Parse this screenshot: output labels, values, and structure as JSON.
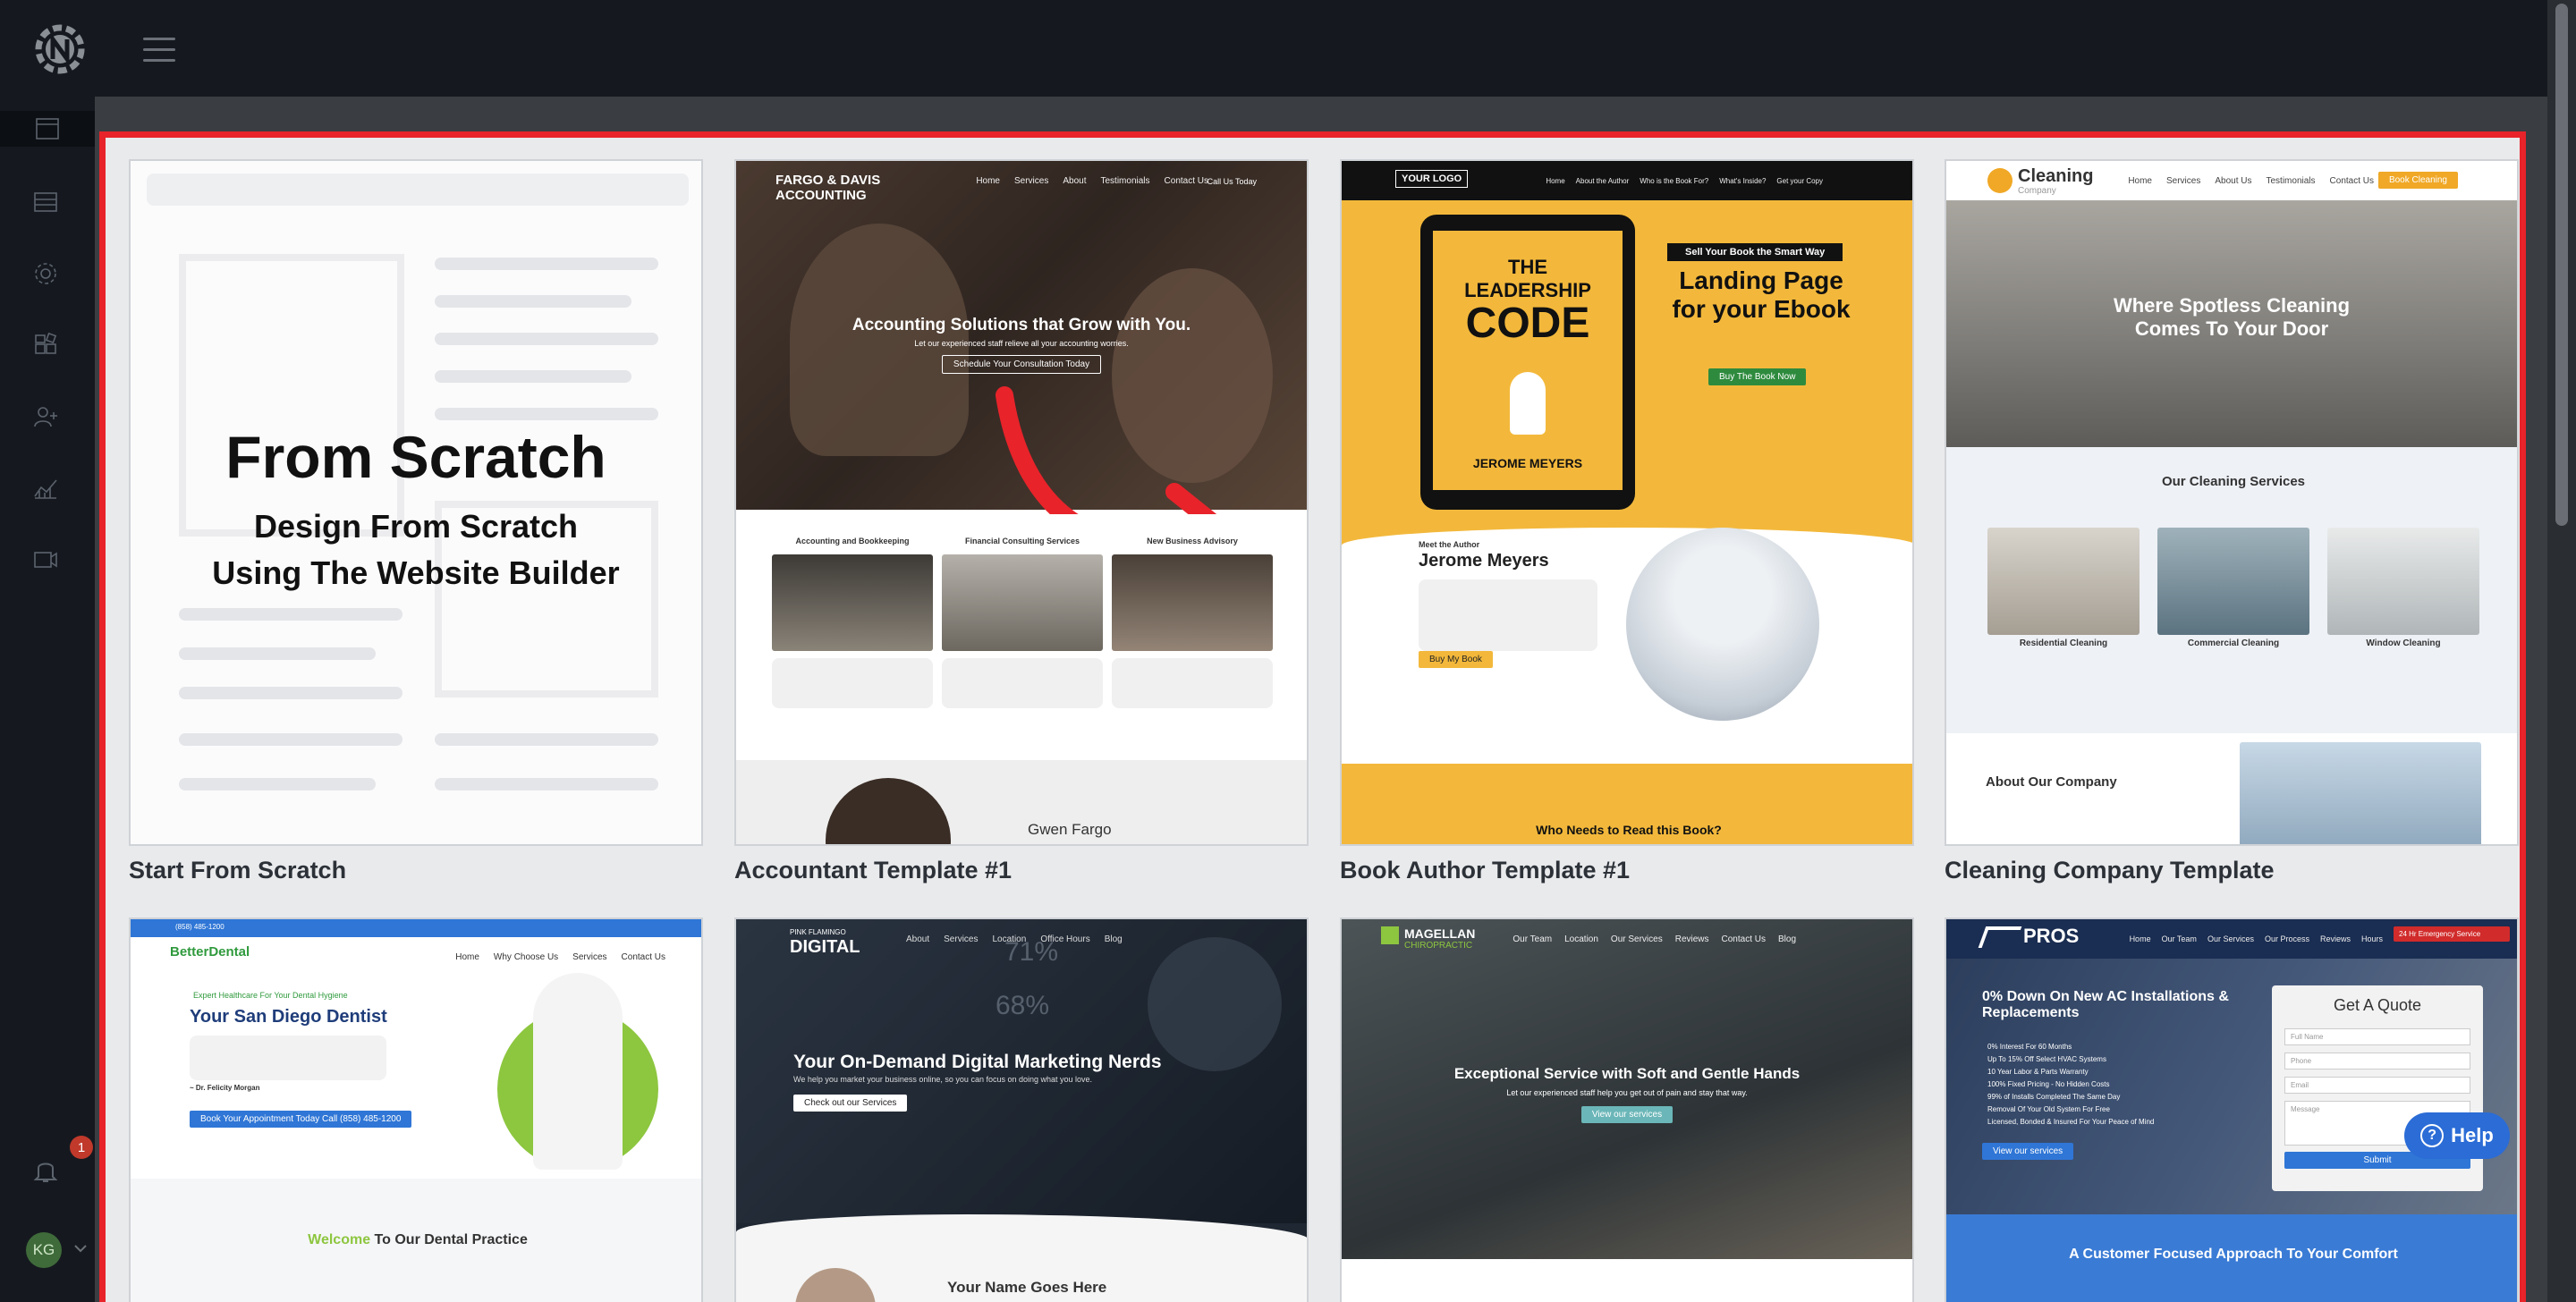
{
  "nav": {
    "icons": [
      "logo-icon",
      "menu-icon",
      "websites-icon",
      "list-icon",
      "settings-icon",
      "widgets-icon",
      "add-user-icon",
      "analytics-icon",
      "video-icon"
    ],
    "notification_count": "1",
    "user_initials": "KG"
  },
  "help_label": "Help",
  "templates": [
    {
      "name": "Start From Scratch",
      "title": "From Scratch",
      "subtitle_line1": "Design From Scratch",
      "subtitle_line2": "Using The Website Builder"
    },
    {
      "name": "Accountant Template #1",
      "brand": "FARGO & DAVIS ACCOUNTING",
      "nav": [
        "Home",
        "Services",
        "About",
        "Testimonials",
        "Contact Us"
      ],
      "cta_top": "Call Us Today",
      "headline": "Accounting Solutions that Grow with You.",
      "subline": "Let our experienced staff relieve all your accounting worries.",
      "button": "Schedule Your Consultation Today",
      "services": [
        "Accounting and Bookkeeping",
        "Financial Consulting Services",
        "New Business Advisory"
      ],
      "person": "Gwen Fargo"
    },
    {
      "name": "Book Author Template #1",
      "logo": "YOUR LOGO",
      "nav": [
        "Home",
        "About the Author",
        "Who is the Book For?",
        "What's Inside?",
        "Get your Copy"
      ],
      "book_title_1": "THE",
      "book_title_2": "LEADERSHIP",
      "book_title_3": "CODE",
      "book_author": "JEROME MEYERS",
      "tag": "Sell Your Book the Smart Way",
      "headline_1": "Landing Page",
      "headline_2": "for your Ebook",
      "button": "Buy The Book Now",
      "meet": "Meet the Author",
      "author_name": "Jerome Meyers",
      "buy_button": "Buy My Book",
      "bottom": "Who Needs to Read this Book?"
    },
    {
      "name": "Cleaning Company Template",
      "brand": "Cleaning",
      "brand_sub": "Company",
      "nav": [
        "Home",
        "Services",
        "About Us",
        "Testimonials",
        "Contact Us"
      ],
      "cta": "Book Cleaning",
      "headline_1": "Where Spotless Cleaning",
      "headline_2": "Comes To Your Door",
      "services_title": "Our Cleaning Services",
      "services": [
        "Residential Cleaning",
        "Commercial Cleaning",
        "Window Cleaning"
      ],
      "about": "About Our Company"
    },
    {
      "name": "",
      "brand": "BetterDental",
      "topbar_left": "(858) 485-1200",
      "nav": [
        "Home",
        "Why Choose Us",
        "Services",
        "Contact Us"
      ],
      "tagline": "Expert Healthcare For Your Dental Hygiene",
      "headline": "Your San Diego Dentist",
      "signature": "~ Dr. Felicity Morgan",
      "button": "Book Your Appointment Today Call (858) 485-1200",
      "welcome_1": "Welcome",
      "welcome_2": "To Our Dental Practice"
    },
    {
      "name": "",
      "brand_1": "PINK FLAMINGO",
      "brand_2": "DIGITAL",
      "nav": [
        "About",
        "Services",
        "Location",
        "Office Hours",
        "Blog"
      ],
      "headline": "Your On-Demand Digital Marketing Nerds",
      "subline": "We help you market your business online, so you can focus on doing what you love.",
      "button": "Check out our Services",
      "bottom": "Your Name Goes Here",
      "stat_1": "71%",
      "stat_2": "68%"
    },
    {
      "name": "",
      "brand_1": "MAGELLAN",
      "brand_2": "CHIROPRACTIC",
      "nav": [
        "Our Team",
        "Location",
        "Our Services",
        "Reviews",
        "Contact Us",
        "Blog"
      ],
      "headline": "Exceptional Service with Soft and Gentle Hands",
      "subline": "Let our experienced staff help you get out of pain and stay that way.",
      "button": "View our services"
    },
    {
      "name": "",
      "brand": "PROS",
      "nav": [
        "Home",
        "Our Team",
        "Our Services",
        "Our Process",
        "Reviews",
        "Hours"
      ],
      "cta": "24 Hr Emergency Service",
      "headline": "0% Down On New AC Installations & Replacements",
      "bullets": [
        "0% Interest For 60 Months",
        "Up To 15% Off Select HVAC Systems",
        "10 Year Labor & Parts Warranty",
        "100% Fixed Pricing - No Hidden Costs",
        "99% of Installs Completed The Same Day",
        "Removal Of Your Old System For Free",
        "Licensed, Bonded & Insured For Your Peace of Mind"
      ],
      "button": "View our services",
      "quote_title": "Get A Quote",
      "fields": [
        "Full Name",
        "Phone",
        "Email",
        "Message"
      ],
      "submit": "Submit",
      "bottom": "A Customer Focused Approach To Your Comfort"
    }
  ],
  "colors": {
    "accent": "#e8232a",
    "sidebar": "#15191f",
    "help": "#2b6cd6",
    "book_yellow": "#f3b83b"
  }
}
